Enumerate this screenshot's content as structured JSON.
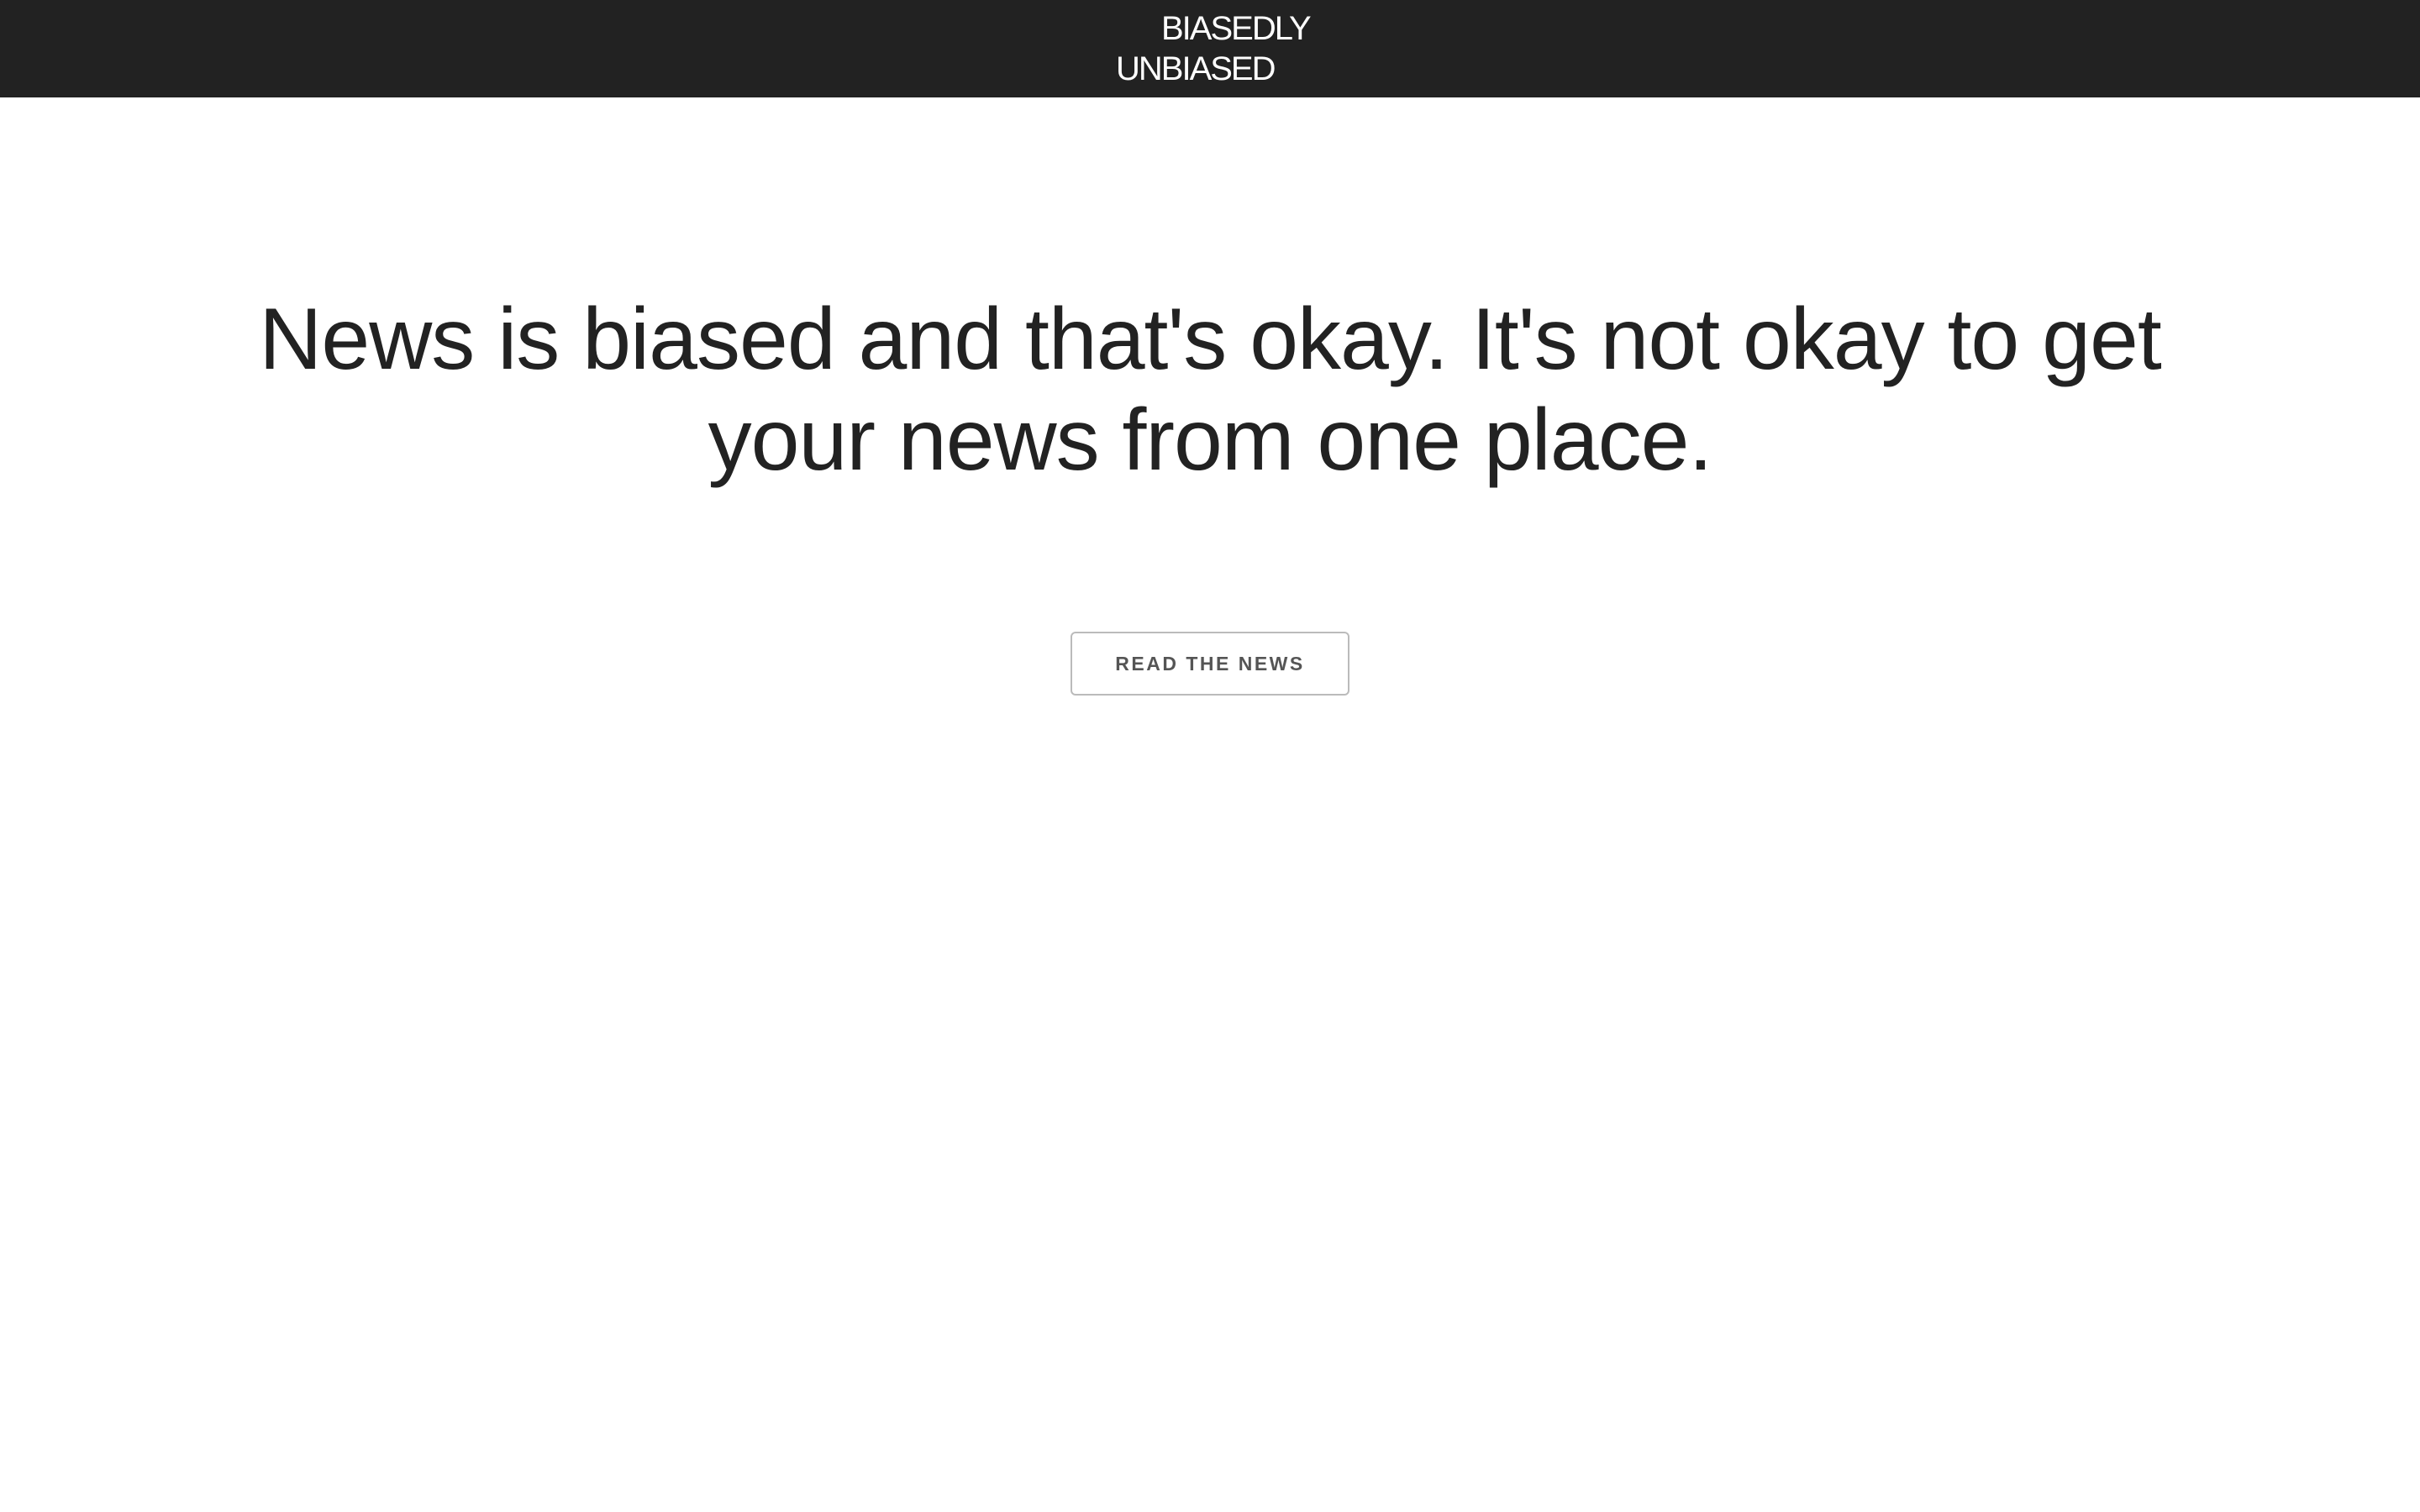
{
  "header": {
    "logo_line1": "BIASEDLY",
    "logo_line2": "UNBIASED"
  },
  "hero": {
    "headline": "News is biased and that's okay. It's not okay to get your news from one place.",
    "cta_label": "READ THE NEWS"
  },
  "colors": {
    "header_bg": "#222222",
    "text": "#222222",
    "button_border": "#bbbbbb"
  }
}
